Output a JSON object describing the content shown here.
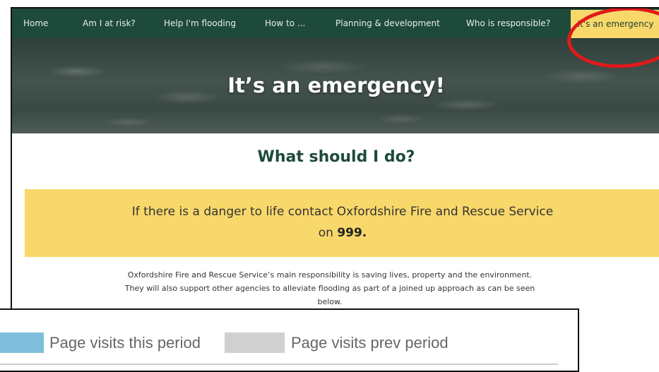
{
  "nav": {
    "items": [
      "Home",
      "Am I at risk?",
      "Help I'm flooding",
      "How to ...",
      "Planning & development",
      "Who is responsible?"
    ],
    "active_item": "It's an emergency",
    "background": "#1e4a3c",
    "active_background": "#f8d86a"
  },
  "hero": {
    "title": "It’s an emergency!"
  },
  "content": {
    "subheading": "What should I do?",
    "alert_text_before": "If there is a danger to life contact Oxfordshire Fire and Rescue Service on ",
    "alert_number": "999.",
    "body_text": "Oxfordshire Fire and Rescue Service’s main responsibility is saving lives, property and the environment. They will also support other agencies to alleviate flooding as part of a joined up approach as can be seen below."
  },
  "legend": {
    "entries": [
      {
        "label": "Page visits this period",
        "color": "#7fbfdb"
      },
      {
        "label": "Page visits prev period",
        "color": "#d0d0d0"
      }
    ]
  },
  "annotation": {
    "highlight_color": "#e01a1a"
  }
}
